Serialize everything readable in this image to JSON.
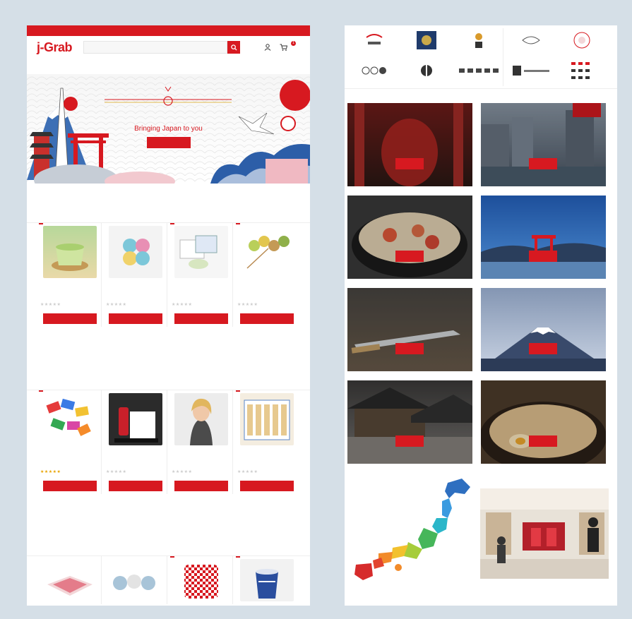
{
  "left_page": {
    "promo_text": "",
    "header_right_text": "",
    "logo": "j-Grab",
    "search_placeholder": "",
    "account_text": "",
    "cart_count": "1",
    "nav_items": [
      "",
      "",
      "",
      "",
      ""
    ],
    "hero": {
      "title": "Bringing Japan to you",
      "button_label": ""
    },
    "featured": {
      "title": "",
      "products": [
        {
          "badge": "",
          "brand": "",
          "name": "",
          "price": "",
          "old_price": "",
          "stars": "★★★★★",
          "button": ""
        },
        {
          "badge": "",
          "brand": "",
          "name": "",
          "price": "",
          "old_price": "",
          "stars": "★★★★★",
          "button": ""
        },
        {
          "badge": "",
          "brand": "",
          "name": "",
          "price": "",
          "old_price": "",
          "stars": "★★★★★",
          "button": ""
        },
        {
          "badge": "",
          "brand": "",
          "name": "",
          "price": "",
          "old_price": "",
          "stars": "★★★★★",
          "button": ""
        }
      ]
    },
    "best_selling": {
      "title": "",
      "products": [
        {
          "badge": "",
          "brand": "",
          "name": "",
          "price": "",
          "old_price": "",
          "stars": "★★★★★",
          "button": ""
        },
        {
          "badge": "",
          "brand": "",
          "name": "",
          "price": "",
          "old_price": "",
          "stars": "★★★★★",
          "button": ""
        },
        {
          "badge": "",
          "brand": "",
          "name": "",
          "price": "",
          "old_price": "",
          "stars": "★★★★★",
          "button": ""
        },
        {
          "badge": "",
          "brand": "",
          "name": "",
          "price": "",
          "old_price": "",
          "stars": "★★★★★",
          "button": ""
        }
      ]
    },
    "new_products": {
      "title": "",
      "view_all": "",
      "badges": [
        "",
        ""
      ]
    }
  },
  "right_page": {
    "brand_logos": [
      "",
      "",
      "",
      "",
      "",
      "",
      "",
      "",
      "",
      ""
    ],
    "regions": [
      {
        "name": "",
        "desc": "",
        "button": ""
      },
      {
        "name": "",
        "desc": "",
        "button": ""
      },
      {
        "name": "",
        "desc": "",
        "button": ""
      },
      {
        "name": "",
        "desc": "",
        "button": ""
      },
      {
        "name": "",
        "desc": "",
        "button": ""
      },
      {
        "name": "",
        "desc": "",
        "button": ""
      },
      {
        "name": "",
        "desc": "",
        "button": ""
      },
      {
        "name": "",
        "desc": "",
        "button": ""
      }
    ]
  },
  "colors": {
    "brand_red": "#d71920",
    "frame_bg": "#d5dfe7"
  },
  "icons": [
    "search-icon",
    "user-icon",
    "cart-icon",
    "star-icon"
  ]
}
